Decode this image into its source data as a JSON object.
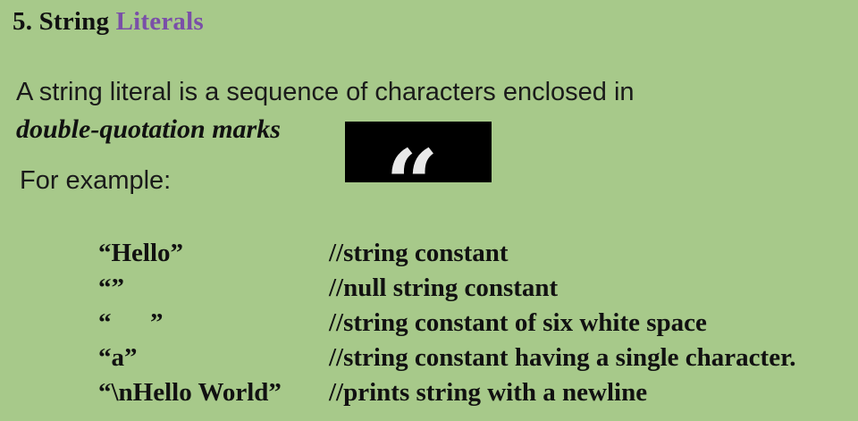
{
  "heading": {
    "prefix": "5. String ",
    "accent": "Literals",
    "accent_color": "#7a4fa8"
  },
  "intro": "A string literal is a sequence of characters enclosed in",
  "emphasis": "double-quotation marks",
  "quote_marks": "“ ”",
  "example_label": "For example:",
  "examples": [
    {
      "literal": "“Hello”",
      "comment": "//string constant"
    },
    {
      "literal": "“”",
      "comment": "//null string constant"
    },
    {
      "literal": "“      ”",
      "comment": "//string constant of six white space"
    },
    {
      "literal": "“a”",
      "comment": "//string constant having a single character."
    },
    {
      "literal": "“\\nHello World”",
      "comment": "//prints string with a newline"
    }
  ],
  "colors": {
    "background": "#a7c98a",
    "text": "#111111",
    "quote_box": "#000000"
  }
}
